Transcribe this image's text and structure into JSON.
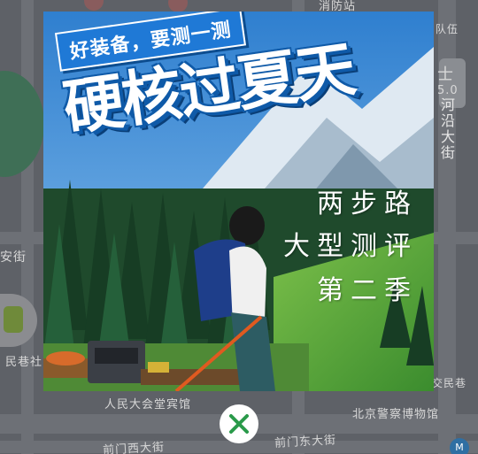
{
  "map": {
    "labels": {
      "top_right_partial": "消防站",
      "team": "队伍",
      "compass": "士",
      "version": "5.0",
      "road_vertical": "河沿大街",
      "left_an": "安街",
      "left_people": "民巷社",
      "hall": "人民大会堂宾馆",
      "police_museum": "北京警察博物馆",
      "right_jiao": "交民巷",
      "qianmen_west": "前门西大街",
      "qianmen_east": "前门东大街"
    }
  },
  "ad": {
    "tagline": "好装备，要测一测",
    "headline": "硬核过夏天",
    "sub_lines": [
      "两步路",
      "大型测评",
      "第二季"
    ]
  },
  "icons": {
    "close": "close-x-icon",
    "subway": "subway-icon"
  },
  "colors": {
    "close_x": "#2a9a4a",
    "headline_fill": "#ffffff",
    "headline_outline": "#0f5aa8",
    "ribbon": "#1f79d6"
  }
}
